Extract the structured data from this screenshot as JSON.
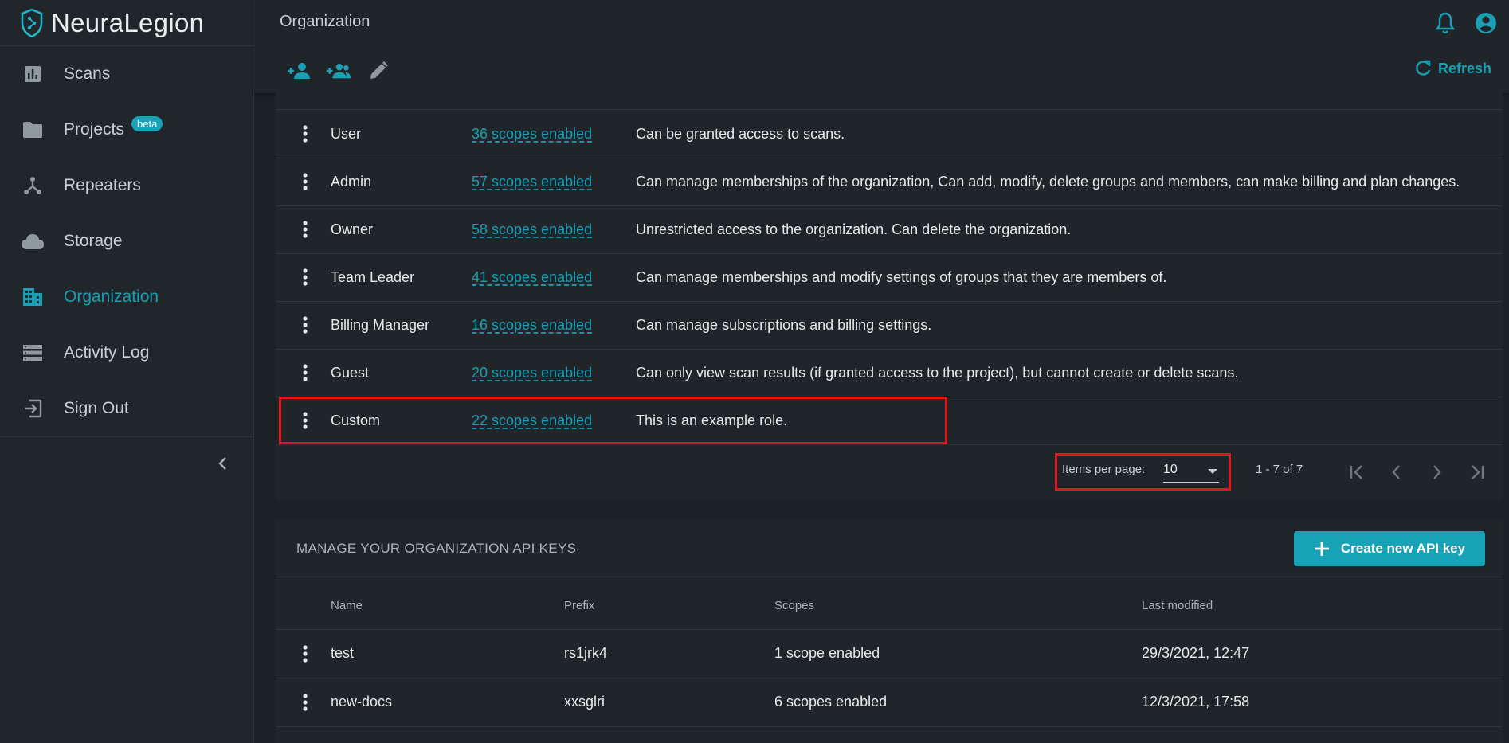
{
  "brand": {
    "name": "NeuraLegion"
  },
  "sidebar": {
    "items": [
      {
        "label": "Scans",
        "icon": "bar-chart-icon"
      },
      {
        "label": "Projects",
        "icon": "folder-icon",
        "badge": "beta"
      },
      {
        "label": "Repeaters",
        "icon": "hub-icon"
      },
      {
        "label": "Storage",
        "icon": "cloud-icon"
      },
      {
        "label": "Organization",
        "icon": "building-icon",
        "active": true
      },
      {
        "label": "Activity Log",
        "icon": "list-icon"
      },
      {
        "label": "Sign Out",
        "icon": "sign-out-icon"
      }
    ]
  },
  "header": {
    "title": "Organization",
    "refresh_label": "Refresh"
  },
  "roles": {
    "rows": [
      {
        "name": "User",
        "scopes": "36 scopes enabled",
        "description": "Can be granted access to scans."
      },
      {
        "name": "Admin",
        "scopes": "57 scopes enabled",
        "description": "Can manage memberships of the organization, Can add, modify, delete groups and members, can make billing and plan changes."
      },
      {
        "name": "Owner",
        "scopes": "58 scopes enabled",
        "description": "Unrestricted access to the organization. Can delete the organization."
      },
      {
        "name": "Team Leader",
        "scopes": "41 scopes enabled",
        "description": "Can manage memberships and modify settings of groups that they are members of."
      },
      {
        "name": "Billing Manager",
        "scopes": "16 scopes enabled",
        "description": "Can manage subscriptions and billing settings."
      },
      {
        "name": "Guest",
        "scopes": "20 scopes enabled",
        "description": "Can only view scan results (if granted access to the project), but cannot create or delete scans."
      },
      {
        "name": "Custom",
        "scopes": "22 scopes enabled",
        "description": "This is an example role."
      }
    ],
    "paginator": {
      "items_per_page_label": "Items per page:",
      "items_per_page_value": "10",
      "range": "1 - 7 of 7"
    }
  },
  "api_keys": {
    "title": "MANAGE YOUR ORGANIZATION API KEYS",
    "create_label": "Create new API key",
    "columns": [
      "Name",
      "Prefix",
      "Scopes",
      "Last modified"
    ],
    "rows": [
      {
        "name": "test",
        "prefix": "rs1jrk4",
        "scopes": "1 scope enabled",
        "last_modified": "29/3/2021, 12:47"
      },
      {
        "name": "new-docs",
        "prefix": "xxsglri",
        "scopes": "6 scopes enabled",
        "last_modified": "12/3/2021, 17:58"
      }
    ]
  },
  "colors": {
    "accent": "#17a2b8",
    "highlight": "#e0161b",
    "background": "#1c2126"
  }
}
